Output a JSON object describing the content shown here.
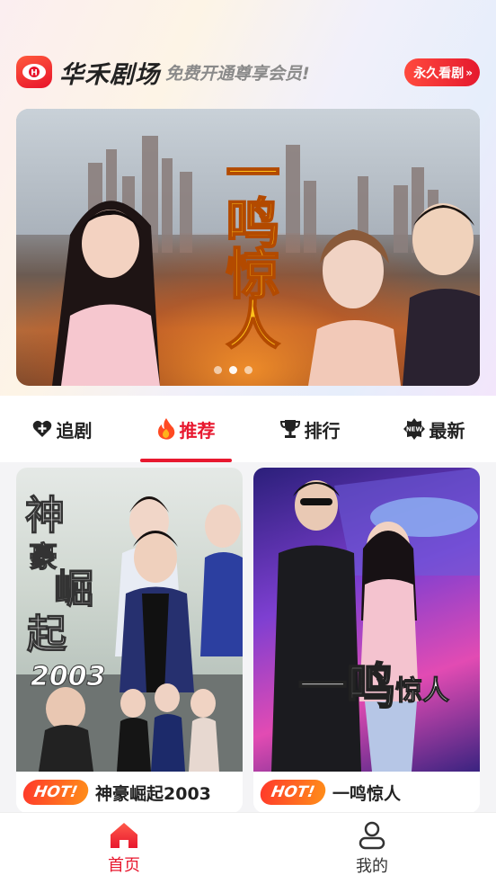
{
  "header": {
    "app_name": "华禾剧场",
    "slogan": "免费开通尊享会员!",
    "vip_button": "永久看剧",
    "vip_chevron": "»"
  },
  "banner": {
    "title_art": "一鸣惊人",
    "dot_count": 3,
    "active_dot": 2
  },
  "tabs": [
    {
      "label": "追剧",
      "icon": "plus-heart-icon",
      "active": false
    },
    {
      "label": "推荐",
      "icon": "flame-icon",
      "active": true
    },
    {
      "label": "排行",
      "icon": "trophy-icon",
      "active": false
    },
    {
      "label": "最新",
      "icon": "new-badge-icon",
      "active": false
    }
  ],
  "cards": [
    {
      "badge": "HOT!",
      "title": "神豪崛起2003",
      "poster_text": "神豪崛起",
      "poster_year": "2003"
    },
    {
      "badge": "HOT!",
      "title": "一鸣惊人",
      "poster_text": "一鸣",
      "poster_text2": "惊人"
    }
  ],
  "bottom_nav": [
    {
      "label": "首页",
      "icon": "home-icon",
      "active": true
    },
    {
      "label": "我的",
      "icon": "person-icon",
      "active": false
    }
  ],
  "colors": {
    "accent": "#e8182f",
    "text": "#222222",
    "muted": "#8a8a8a"
  }
}
